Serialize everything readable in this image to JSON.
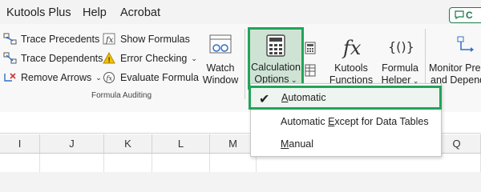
{
  "tabs": {
    "kutools_plus": "Kutools Plus",
    "help": "Help",
    "acrobat": "Acrobat",
    "share_label": "C"
  },
  "formula_auditing": {
    "trace_precedents": "Trace Precedents",
    "trace_dependents": "Trace Dependents",
    "remove_arrows": "Remove Arrows",
    "show_formulas": "Show Formulas",
    "error_checking": "Error Checking",
    "evaluate_formula": "Evaluate Formula",
    "group_label": "Formula Auditing"
  },
  "watch_window": {
    "line1": "Watch",
    "line2": "Window"
  },
  "calculation_options": {
    "line1": "Calculation",
    "line2": "Options"
  },
  "kutools_functions": {
    "line1": "Kutools",
    "line2": "Functions"
  },
  "formula_helper": {
    "line1": "Formula",
    "line2": "Helper"
  },
  "monitor": {
    "line1": "Monitor Prec",
    "line2": "and Depend"
  },
  "calc_menu": {
    "items": [
      {
        "pre": "",
        "ul": "A",
        "post": "utomatic",
        "checked": true
      },
      {
        "pre": "Automatic ",
        "ul": "E",
        "post": "xcept for Data Tables",
        "checked": false
      },
      {
        "pre": "",
        "ul": "M",
        "post": "anual",
        "checked": false
      }
    ]
  },
  "columns": [
    "I",
    "J",
    "K",
    "L",
    "M",
    "Q"
  ],
  "colors": {
    "accent_green": "#22a35a",
    "excel_green": "#1e7b4c"
  }
}
